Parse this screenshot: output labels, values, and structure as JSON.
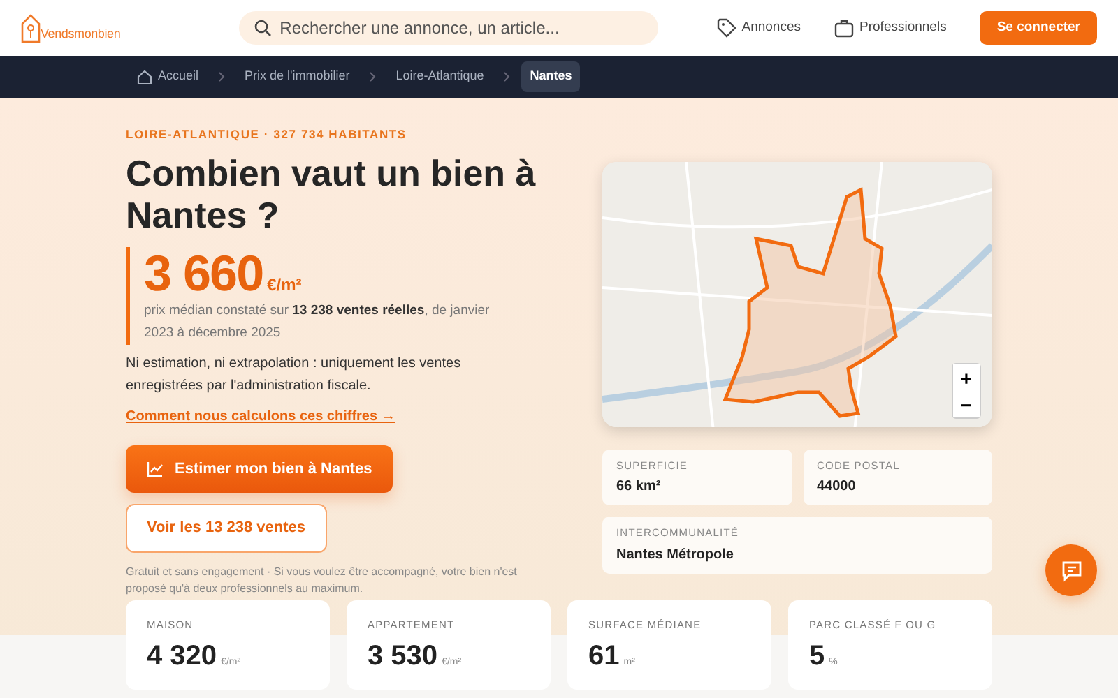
{
  "header": {
    "logo_text": "Vendsmonbien",
    "search": {
      "placeholder": "Rechercher une annonce, un article..."
    },
    "nav": [
      {
        "label": "Annonces"
      },
      {
        "label": "Professionnels"
      }
    ],
    "login_button": "Se connecter"
  },
  "breadcrumb": [
    {
      "label": "Accueil",
      "selected": false
    },
    {
      "label": "Prix de l'immobilier",
      "selected": false
    },
    {
      "label": "Loire-Atlantique",
      "selected": false
    },
    {
      "label": "Nantes",
      "selected": true
    }
  ],
  "hero": {
    "eyebrow": "LOIRE-ATLANTIQUE · 327 734 HABITANTS",
    "title": "Combien vaut un bien à Nantes ?",
    "price": "3 660",
    "price_unit": "€/m²",
    "price_note": "prix médian constaté sur **13 238 ventes réelles**, de janvier 2023 à décembre 2025",
    "description": "Ni estimation, ni extrapolation : uniquement les ventes enregistrées par l'administration fiscale.",
    "method_link": "Comment nous calculons ces chiffres →",
    "primary_button": "Estimer mon bien à Nantes",
    "secondary_button": "Voir les 13 238 ventes",
    "disclaimer": "Gratuit et sans engagement · Si vous voulez être accompagné, votre bien n'est proposé qu'à deux professionnels au maximum."
  },
  "map": {
    "zoom_in": "+",
    "zoom_out": "−"
  },
  "facts": [
    {
      "label": "SUPERFICIE",
      "value": "66 km²"
    },
    {
      "label": "CODE POSTAL",
      "value": "44000"
    },
    {
      "label": "INTERCOMMUNALITÉ",
      "value": "Nantes Métropole"
    }
  ],
  "stats": [
    {
      "label": "MAISON",
      "value": "4 320",
      "unit": "€/m²"
    },
    {
      "label": "APPARTEMENT",
      "value": "3 530",
      "unit": "€/m²"
    },
    {
      "label": "SURFACE MÉDIANE",
      "value": "61",
      "unit": "m²"
    },
    {
      "label": "PARC CLASSÉ F OU G",
      "value": "5",
      "unit": "%"
    }
  ]
}
